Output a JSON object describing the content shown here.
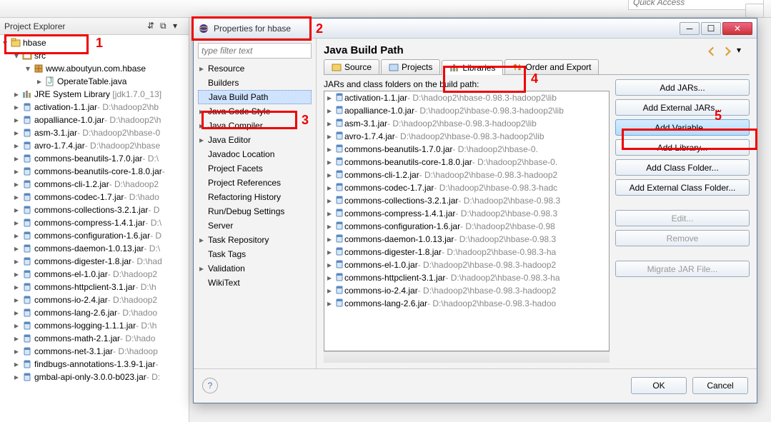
{
  "top": {
    "quick_access": "Quick Access"
  },
  "explorer": {
    "title": "Project Explorer",
    "project": "hbase",
    "src": "src",
    "pkg": "www.aboutyun.com.hbase",
    "javafile": "OperateTable.java",
    "jre": "JRE System Library",
    "jre_ver": "[jdk1.7.0_13]",
    "jars": [
      {
        "name": "activation-1.1.jar",
        "path": " - D:\\hadoop2\\hb"
      },
      {
        "name": "aopalliance-1.0.jar",
        "path": " - D:\\hadoop2\\h"
      },
      {
        "name": "asm-3.1.jar",
        "path": " - D:\\hadoop2\\hbase-0"
      },
      {
        "name": "avro-1.7.4.jar",
        "path": " - D:\\hadoop2\\hbase"
      },
      {
        "name": "commons-beanutils-1.7.0.jar",
        "path": " - D:\\"
      },
      {
        "name": "commons-beanutils-core-1.8.0.jar",
        "path": " - "
      },
      {
        "name": "commons-cli-1.2.jar",
        "path": " - D:\\hadoop2"
      },
      {
        "name": "commons-codec-1.7.jar",
        "path": " - D:\\hado"
      },
      {
        "name": "commons-collections-3.2.1.jar",
        "path": " - D"
      },
      {
        "name": "commons-compress-1.4.1.jar",
        "path": " - D:\\"
      },
      {
        "name": "commons-configuration-1.6.jar",
        "path": " - D"
      },
      {
        "name": "commons-daemon-1.0.13.jar",
        "path": " - D:\\"
      },
      {
        "name": "commons-digester-1.8.jar",
        "path": " - D:\\had"
      },
      {
        "name": "commons-el-1.0.jar",
        "path": " - D:\\hadoop2"
      },
      {
        "name": "commons-httpclient-3.1.jar",
        "path": " - D:\\h"
      },
      {
        "name": "commons-io-2.4.jar",
        "path": " - D:\\hadoop2"
      },
      {
        "name": "commons-lang-2.6.jar",
        "path": " - D:\\hadoo"
      },
      {
        "name": "commons-logging-1.1.1.jar",
        "path": " - D:\\h"
      },
      {
        "name": "commons-math-2.1.jar",
        "path": " - D:\\hado"
      },
      {
        "name": "commons-net-3.1.jar",
        "path": " - D:\\hadoop"
      },
      {
        "name": "findbugs-annotations-1.3.9-1.jar",
        "path": " - "
      },
      {
        "name": "gmbal-api-only-3.0.0-b023.jar",
        "path": " - D:"
      }
    ]
  },
  "dialog": {
    "title": "Properties for hbase",
    "filter_placeholder": "type filter text",
    "categories": [
      "Resource",
      "Builders",
      "Java Build Path",
      "Java Code Style",
      "Java Compiler",
      "Java Editor",
      "Javadoc Location",
      "Project Facets",
      "Project References",
      "Refactoring History",
      "Run/Debug Settings",
      "Server",
      "Task Repository",
      "Task Tags",
      "Validation",
      "WikiText"
    ],
    "selected_category": "Java Build Path",
    "right_title": "Java Build Path",
    "tabs": [
      "Source",
      "Projects",
      "Libraries",
      "Order and Export"
    ],
    "active_tab": "Libraries",
    "jars_label": "JARs and class folders on the build path:",
    "buildpath_jars": [
      {
        "name": "activation-1.1.jar",
        "path": " - D:\\hadoop2\\hbase-0.98.3-hadoop2\\lib"
      },
      {
        "name": "aopalliance-1.0.jar",
        "path": " - D:\\hadoop2\\hbase-0.98.3-hadoop2\\lib"
      },
      {
        "name": "asm-3.1.jar",
        "path": " - D:\\hadoop2\\hbase-0.98.3-hadoop2\\lib"
      },
      {
        "name": "avro-1.7.4.jar",
        "path": " - D:\\hadoop2\\hbase-0.98.3-hadoop2\\lib"
      },
      {
        "name": "commons-beanutils-1.7.0.jar",
        "path": " - D:\\hadoop2\\hbase-0."
      },
      {
        "name": "commons-beanutils-core-1.8.0.jar",
        "path": " - D:\\hadoop2\\hbase-0."
      },
      {
        "name": "commons-cli-1.2.jar",
        "path": " - D:\\hadoop2\\hbase-0.98.3-hadoop2"
      },
      {
        "name": "commons-codec-1.7.jar",
        "path": " - D:\\hadoop2\\hbase-0.98.3-hadc"
      },
      {
        "name": "commons-collections-3.2.1.jar",
        "path": " - D:\\hadoop2\\hbase-0.98.3"
      },
      {
        "name": "commons-compress-1.4.1.jar",
        "path": " - D:\\hadoop2\\hbase-0.98.3"
      },
      {
        "name": "commons-configuration-1.6.jar",
        "path": " - D:\\hadoop2\\hbase-0.98"
      },
      {
        "name": "commons-daemon-1.0.13.jar",
        "path": " - D:\\hadoop2\\hbase-0.98.3"
      },
      {
        "name": "commons-digester-1.8.jar",
        "path": " - D:\\hadoop2\\hbase-0.98.3-ha"
      },
      {
        "name": "commons-el-1.0.jar",
        "path": " - D:\\hadoop2\\hbase-0.98.3-hadoop2"
      },
      {
        "name": "commons-httpclient-3.1.jar",
        "path": " - D:\\hadoop2\\hbase-0.98.3-ha"
      },
      {
        "name": "commons-io-2.4.jar",
        "path": " - D:\\hadoop2\\hbase-0.98.3-hadoop2"
      },
      {
        "name": "commons-lang-2.6.jar",
        "path": " - D:\\hadoop2\\hbase-0.98.3-hadoo"
      }
    ],
    "buttons": {
      "add_jars": "Add JARs...",
      "add_external_jars": "Add External JARs...",
      "add_variable": "Add Variable...",
      "add_library": "Add Library...",
      "add_class_folder": "Add Class Folder...",
      "add_external_class_folder": "Add External Class Folder...",
      "edit": "Edit...",
      "remove": "Remove",
      "migrate": "Migrate JAR File..."
    },
    "ok": "OK",
    "cancel": "Cancel"
  },
  "annotations": {
    "l1": "1",
    "l2": "2",
    "l3": "3",
    "l4": "4",
    "l5": "5"
  }
}
